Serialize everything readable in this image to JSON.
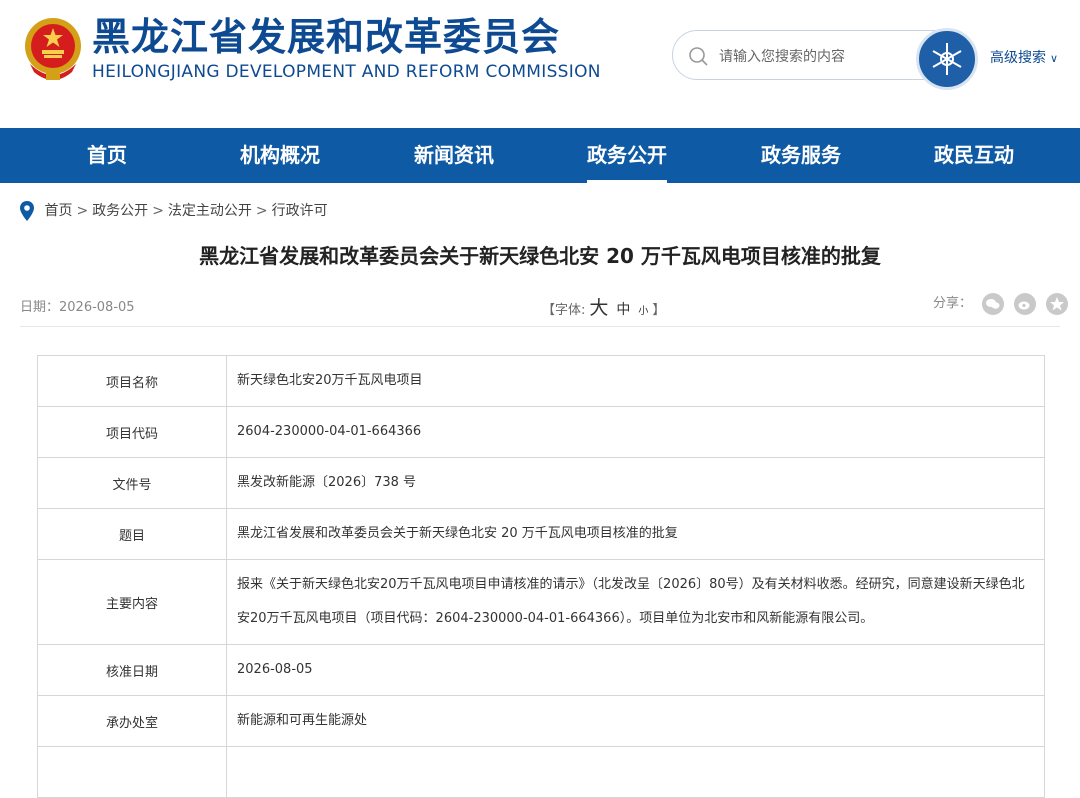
{
  "header": {
    "title": "黑龙江省发展和改革委员会",
    "subtitle": "HEILONGJIANG DEVELOPMENT AND REFORM COMMISSION",
    "search_placeholder": "请输入您搜索的内容",
    "advanced_search": "高级搜索",
    "brand_color": "#0d4a92"
  },
  "nav": {
    "items": [
      "首页",
      "机构概况",
      "新闻资讯",
      "政务公开",
      "政务服务",
      "政民互动"
    ],
    "active": "政务公开",
    "bg_color": "#0f5aa4"
  },
  "breadcrumb": [
    "首页",
    "政务公开",
    "法定主动公开",
    "行政许可"
  ],
  "article": {
    "title": "黑龙江省发展和改革委员会关于新天绿色北安 20 万千瓦风电项目核准的批复",
    "date": "日期：2026-08-05",
    "font_label_open": "【字体:",
    "font_big": "大",
    "font_mid": "中",
    "font_small": "小",
    "font_label_close": "】",
    "share_label": "分享："
  },
  "table": {
    "rows": [
      {
        "label": "项目名称",
        "value": "新天绿色北安20万千瓦风电项目"
      },
      {
        "label": "项目代码",
        "value": "2604-230000-04-01-664366"
      },
      {
        "label": "文件号",
        "value": "黑发改新能源〔2026〕738 号"
      },
      {
        "label": "题目",
        "value": "黑龙江省发展和改革委员会关于新天绿色北安 20 万千瓦风电项目核准的批复"
      },
      {
        "label": "主要内容",
        "value": "报来《关于新天绿色北安20万千瓦风电项目申请核准的请示》（北发改呈〔2026〕80号）及有关材料收悉。经研究，同意建设新天绿色北安20万千瓦风电项目（项目代码：2604-230000-04-01-664366）。项目单位为北安市和风新能源有限公司。"
      },
      {
        "label": "核准日期",
        "value": "2026-08-05"
      },
      {
        "label": "承办处室",
        "value": "新能源和可再生能源处"
      },
      {
        "label": "",
        "value": ""
      }
    ]
  }
}
